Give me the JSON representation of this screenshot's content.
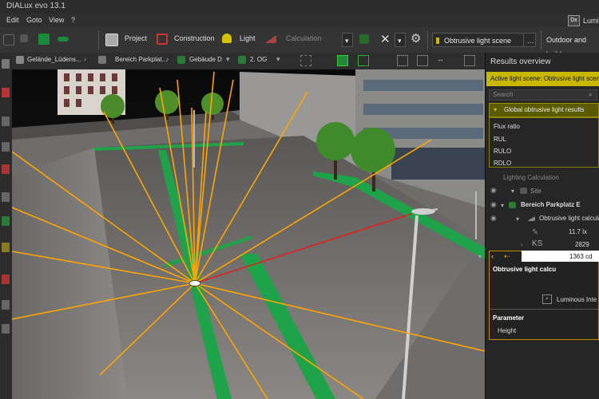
{
  "window": {
    "title": "DIALux evo 13.1"
  },
  "menu": {
    "items": [
      "Edit",
      "Goto",
      "View",
      "?"
    ],
    "user_label": "Lumi"
  },
  "toolbar": {
    "project_label": "Project",
    "construction_label": "Construction",
    "light_label": "Light",
    "calculation_label": "Calculation",
    "scene_select": "Obtrusive light scene",
    "outdoor_label": "Outdoor and build"
  },
  "viewport_tabs": {
    "site": "Gelände_Lüdens...",
    "parking": "Bereich Parkplat...",
    "building": "Gebäude D",
    "floor": "2. OG"
  },
  "results": {
    "title": "Results overview",
    "active_scene": "Active light scene: Obtrusive light scene",
    "search_placeholder": "Search",
    "global_header": "Global obtrusive light results",
    "flux_ratio": "Flux ratio",
    "rul": "RUL",
    "rulo": "RULO",
    "rdlo": "RDLO",
    "lighting_calc": "Lighting Calculation",
    "site": "Site",
    "parking_area": "Bereich Parkplatz E",
    "obtrusive_calc": "Obtrusive light calcula",
    "value_lux": "11.7 lx",
    "value_ks": "2829",
    "ks_label": "KS",
    "selected_value": "1363 cd",
    "detail_title": "Obtrusive light calcu",
    "luminous_label": "Luminous Inte",
    "parameter_label": "Parameter",
    "height_label": "Height"
  },
  "colors": {
    "accent_yellow": "#c9b800",
    "ray_orange": "#ffa500",
    "ray_red": "#e02020",
    "grass_green": "#1fa34a"
  }
}
